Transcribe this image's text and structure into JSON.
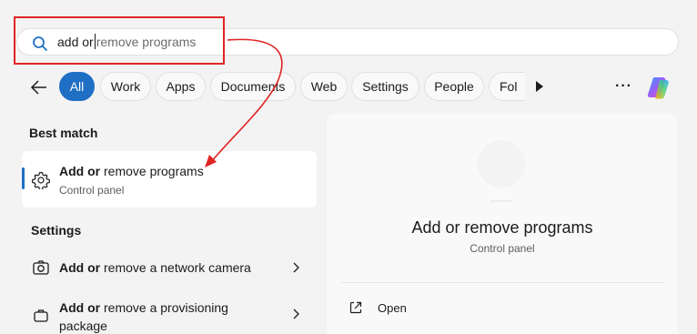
{
  "search": {
    "typed": "add or",
    "suggestion": "remove programs"
  },
  "filters": [
    {
      "label": "All"
    },
    {
      "label": "Work"
    },
    {
      "label": "Apps"
    },
    {
      "label": "Documents"
    },
    {
      "label": "Web"
    },
    {
      "label": "Settings"
    },
    {
      "label": "People"
    },
    {
      "label": "Fol"
    }
  ],
  "best_match": {
    "heading": "Best match",
    "title_bold": "Add or",
    "title_rest": " remove programs",
    "subtitle": "Control panel"
  },
  "settings": {
    "heading": "Settings",
    "items": [
      {
        "title_bold": "Add or",
        "title_rest": " remove a network camera"
      },
      {
        "title_bold": "Add or",
        "title_rest": " remove a provisioning",
        "title_line2": "package"
      }
    ]
  },
  "preview": {
    "title": "Add or remove programs",
    "subtitle": "Control panel",
    "open_label": "Open"
  },
  "colors": {
    "accent": "#1f6fc5",
    "annotation": "#e02424"
  }
}
